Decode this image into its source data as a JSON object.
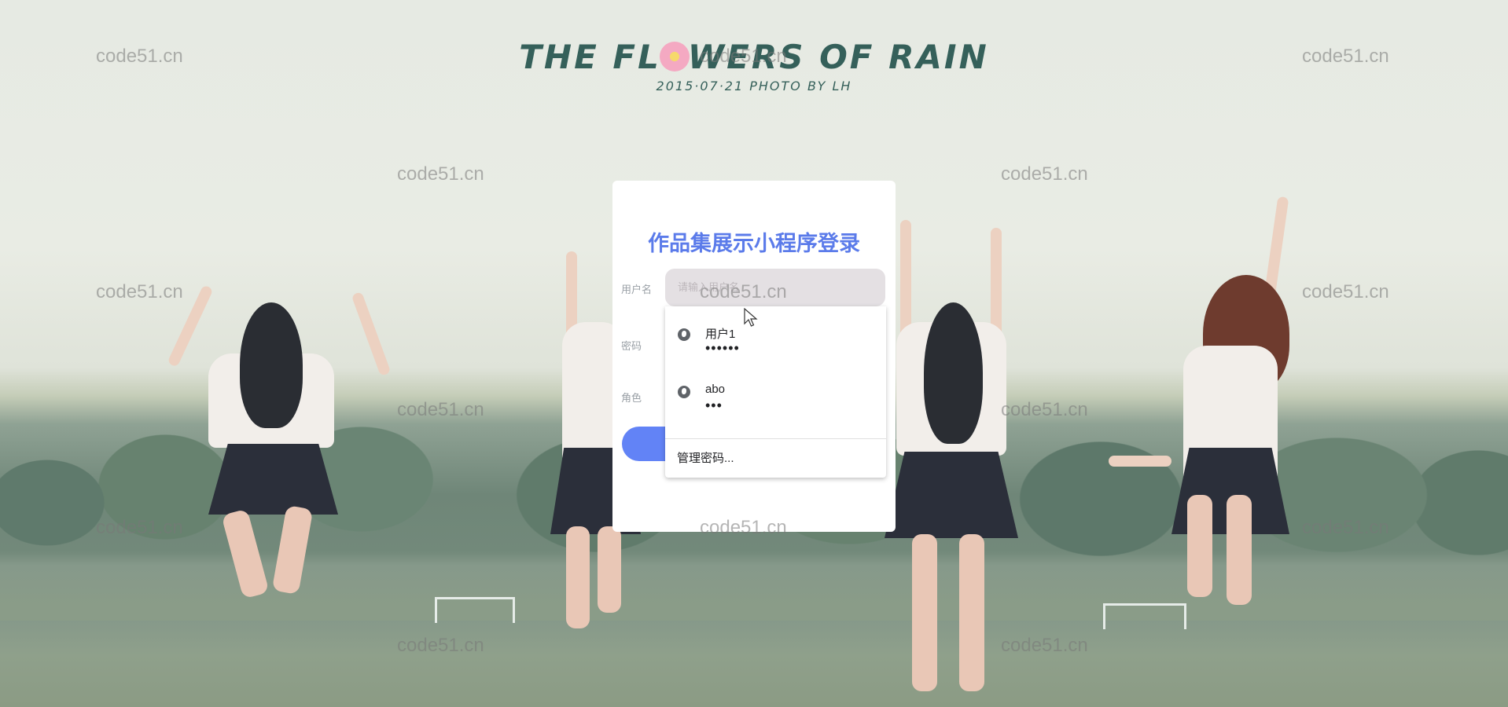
{
  "header": {
    "title_part1": "THE FL",
    "title_part2": "WERS OF RAIN",
    "subtitle": "2015·07·21 PHOTO BY LH"
  },
  "watermark": "code51.cn",
  "login": {
    "title": "作品集展示小程序登录",
    "username_label": "用户名",
    "username_placeholder": "请输入用户名",
    "password_label": "密码",
    "role_label": "角色"
  },
  "autofill": {
    "entries": [
      {
        "username": "用户1",
        "password_mask": "••••••"
      },
      {
        "username": "abo",
        "password_mask": "•••"
      }
    ],
    "manage_label": "管理密码..."
  },
  "colors": {
    "accent": "#5b7bea",
    "button": "#6283f6",
    "input_bg": "#e4e0e3",
    "title_green": "#35605a"
  }
}
